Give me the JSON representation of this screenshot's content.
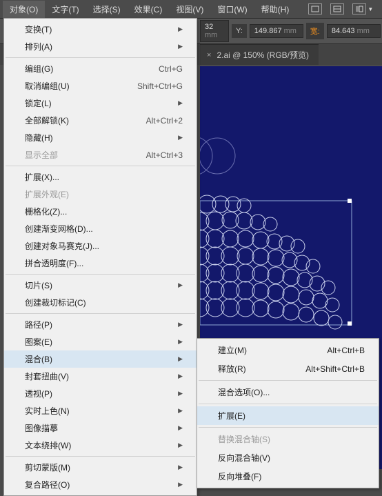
{
  "menubar": {
    "items": [
      "对象(O)",
      "文字(T)",
      "选择(S)",
      "效果(C)",
      "视图(V)",
      "窗口(W)",
      "帮助(H)"
    ],
    "activeIndex": 0
  },
  "toolbar": {
    "unit_suffix": "mm",
    "labels": {
      "y": "Y:",
      "w": "宽:"
    },
    "values": {
      "x_truncated": "32",
      "y": "149.867",
      "w": "84.643"
    }
  },
  "tab": {
    "title": "2.ai @ 150% (RGB/预览)",
    "close": "×"
  },
  "menu": {
    "transform": "变换(T)",
    "arrange": "排列(A)",
    "group": "编组(G)",
    "group_sc": "Ctrl+G",
    "ungroup": "取消编组(U)",
    "ungroup_sc": "Shift+Ctrl+G",
    "lock": "锁定(L)",
    "unlockAll": "全部解锁(K)",
    "unlockAll_sc": "Alt+Ctrl+2",
    "hide": "隐藏(H)",
    "showAll": "显示全部",
    "showAll_sc": "Alt+Ctrl+3",
    "expand": "扩展(X)...",
    "expandAppearance": "扩展外观(E)",
    "rasterize": "栅格化(Z)...",
    "gradientMesh": "创建渐变网格(D)...",
    "objectMosaic": "创建对象马赛克(J)...",
    "flattenTransparency": "拼合透明度(F)...",
    "slice": "切片(S)",
    "cropMarks": "创建裁切标记(C)",
    "path": "路径(P)",
    "pattern": "图案(E)",
    "blend": "混合(B)",
    "envelope": "封套扭曲(V)",
    "perspective": "透视(P)",
    "livePaint": "实时上色(N)",
    "imageTrace": "图像描摹",
    "textWrap": "文本绕排(W)",
    "clipMask": "剪切蒙版(M)",
    "compoundPath": "复合路径(O)"
  },
  "submenu": {
    "make": "建立(M)",
    "make_sc": "Alt+Ctrl+B",
    "release": "释放(R)",
    "release_sc": "Alt+Shift+Ctrl+B",
    "options": "混合选项(O)...",
    "expand": "扩展(E)",
    "replaceSpine": "替换混合轴(S)",
    "reverseSpine": "反向混合轴(V)",
    "reverseFront": "反向堆叠(F)"
  },
  "icons": {
    "arrow": "▶"
  }
}
